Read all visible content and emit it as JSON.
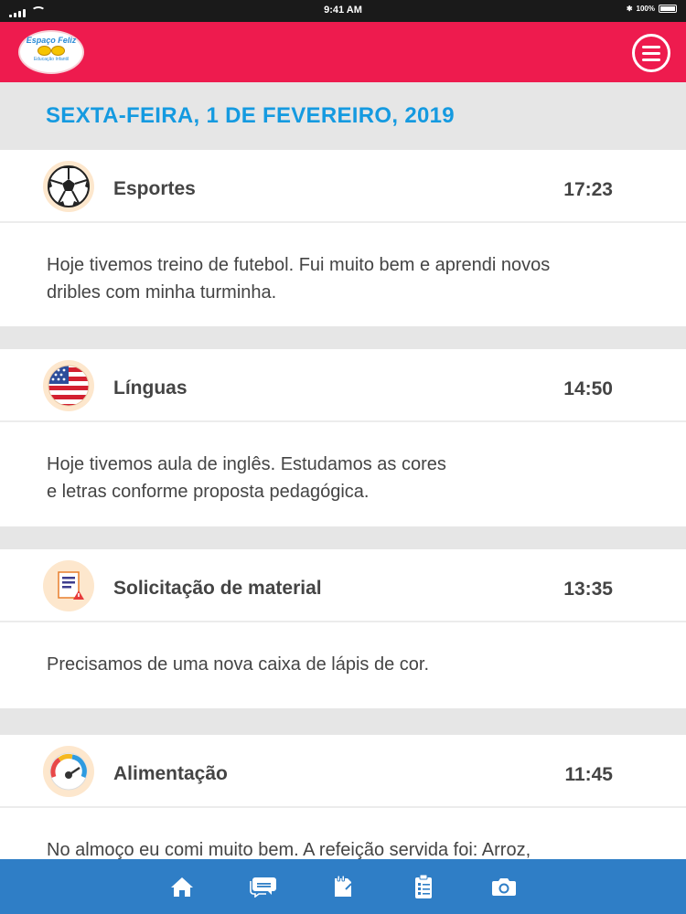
{
  "status_bar": {
    "time": "9:41 AM",
    "battery": "100%"
  },
  "header": {
    "logo_text": "Espaço Feliz",
    "logo_subtext": "Educação Infantil"
  },
  "date_title": "SEXTA-FEIRA, 1 DE FEVEREIRO, 2019",
  "entries": [
    {
      "title": "Esportes",
      "time": "17:23",
      "text": "Hoje tivemos treino de futebol. Fui muito bem e aprendi novos dribles com minha turminha.",
      "icon": "soccer-ball-icon"
    },
    {
      "title": "Línguas",
      "time": "14:50",
      "text": "Hoje tivemos aula de inglês. Estudamos as cores e letras conforme proposta pedagógica.",
      "icon": "usa-flag-icon"
    },
    {
      "title": "Solicitação de material",
      "time": "13:35",
      "text": "Precisamos de uma nova caixa de lápis de cor.",
      "icon": "material-request-icon"
    },
    {
      "title": "Alimentação",
      "time": "11:45",
      "text": "No almoço eu comi muito bem. A refeição servida foi: Arroz,",
      "icon": "meal-gauge-icon"
    }
  ],
  "bottom_nav": [
    "home-icon",
    "chat-icon",
    "notes-icon",
    "checklist-icon",
    "camera-icon"
  ],
  "colors": {
    "header": "#ee1b4e",
    "date": "#159ae0",
    "bottom_nav": "#2f7ec6",
    "icon_bg": "#fde7cd"
  }
}
